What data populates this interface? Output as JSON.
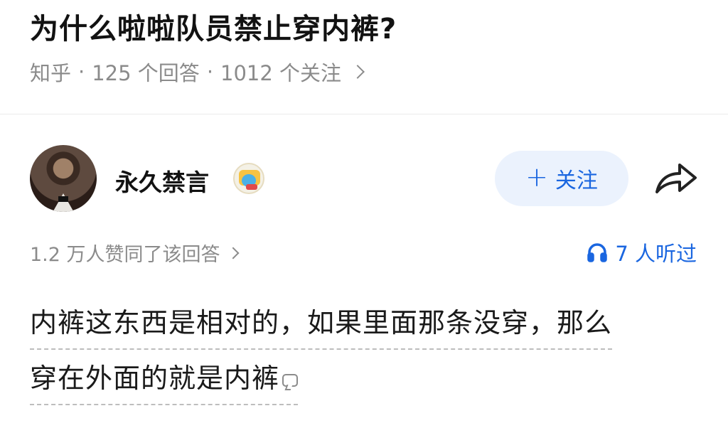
{
  "question": {
    "title": "为什么啦啦队员禁止穿内裤?",
    "source": "知乎",
    "separator": "·",
    "answers_count": "125 个回答",
    "followers_count": "1012 个关注"
  },
  "author": {
    "name": "永久禁言",
    "avatar_icon": "avatar-photo",
    "badge_icon": "badge-icon"
  },
  "follow_button": {
    "plus": "+",
    "label": "关注"
  },
  "share_icon": "share-arrow-icon",
  "stats": {
    "upvote_text": "1.2 万人赞同了该回答",
    "listen_text": "7 人听过",
    "listen_icon": "headphones-icon"
  },
  "answer": {
    "lines": [
      "内裤这东西是相对的，如果里面那条没穿，那么",
      "穿在外面的就是内裤"
    ]
  },
  "colors": {
    "accent": "#1a66e0",
    "follow_bg": "#ebf2fd",
    "meta_gray": "#8b8b8b"
  }
}
